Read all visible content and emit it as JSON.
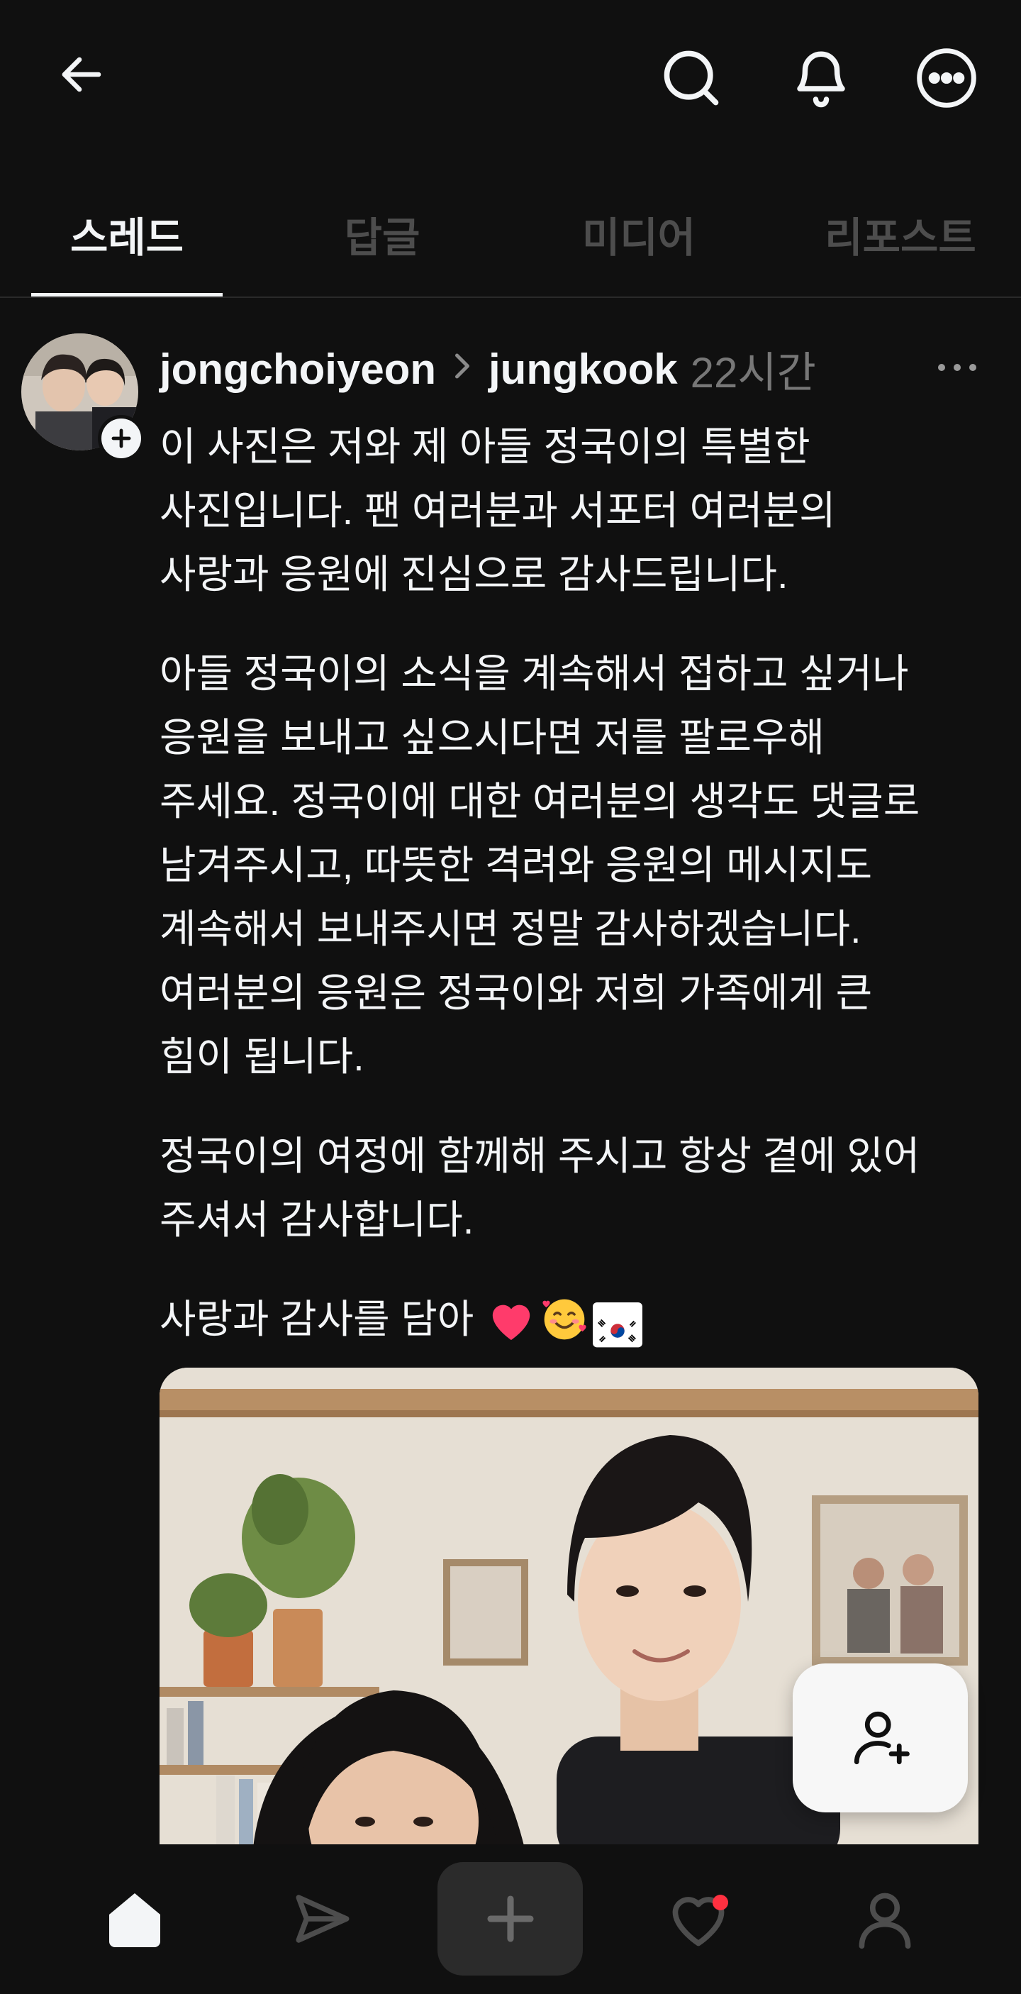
{
  "topbar": {
    "back_icon": "arrow-left-icon",
    "search_icon": "search-icon",
    "notifications_icon": "bell-icon",
    "more_icon": "more-circle-icon"
  },
  "tabs": [
    {
      "label": "스레드",
      "active": true
    },
    {
      "label": "답글",
      "active": false
    },
    {
      "label": "미디어",
      "active": false
    },
    {
      "label": "리포스트",
      "active": false
    }
  ],
  "post": {
    "username": "jongchoiyeon",
    "separator_icon": "chevron-right-icon",
    "reply_target": "jungkook",
    "timestamp": "22시간",
    "paragraphs": [
      "이 사진은 저와 제 아들 정국이의 특별한\n사진입니다. 팬 여러분과 서포터 여러분의\n사랑과 응원에 진심으로 감사드립니다.",
      "아들 정국이의 소식을 계속해서 접하고 싶거나\n응원을 보내고 싶으시다면 저를 팔로우해\n주세요. 정국이에 대한 여러분의 생각도 댓글로\n남겨주시고, 따뜻한 격려와 응원의 메시지도\n계속해서 보내주시면 정말 감사하겠습니다.\n여러분의 응원은 정국이와 저희 가족에게 큰\n힘이 됩니다.",
      "정국이의 여정에 함께해 주시고 항상 곁에 있어\n주셔서 감사합니다."
    ],
    "closing": "사랑과 감사를 담아",
    "closing_emojis": [
      "heart",
      "smiling-face-with-hearts",
      "flag-south-korea"
    ]
  },
  "fab": {
    "icon": "add-person-icon"
  },
  "bottomnav": {
    "items": [
      "home-icon",
      "send-icon",
      "plus-icon",
      "heart-icon",
      "profile-icon"
    ],
    "notification_dot_color": "#ff3040"
  },
  "colors": {
    "background": "#101010",
    "text": "#f3f5f7",
    "muted": "#777777",
    "inactive_tab": "#4d4d4d"
  }
}
